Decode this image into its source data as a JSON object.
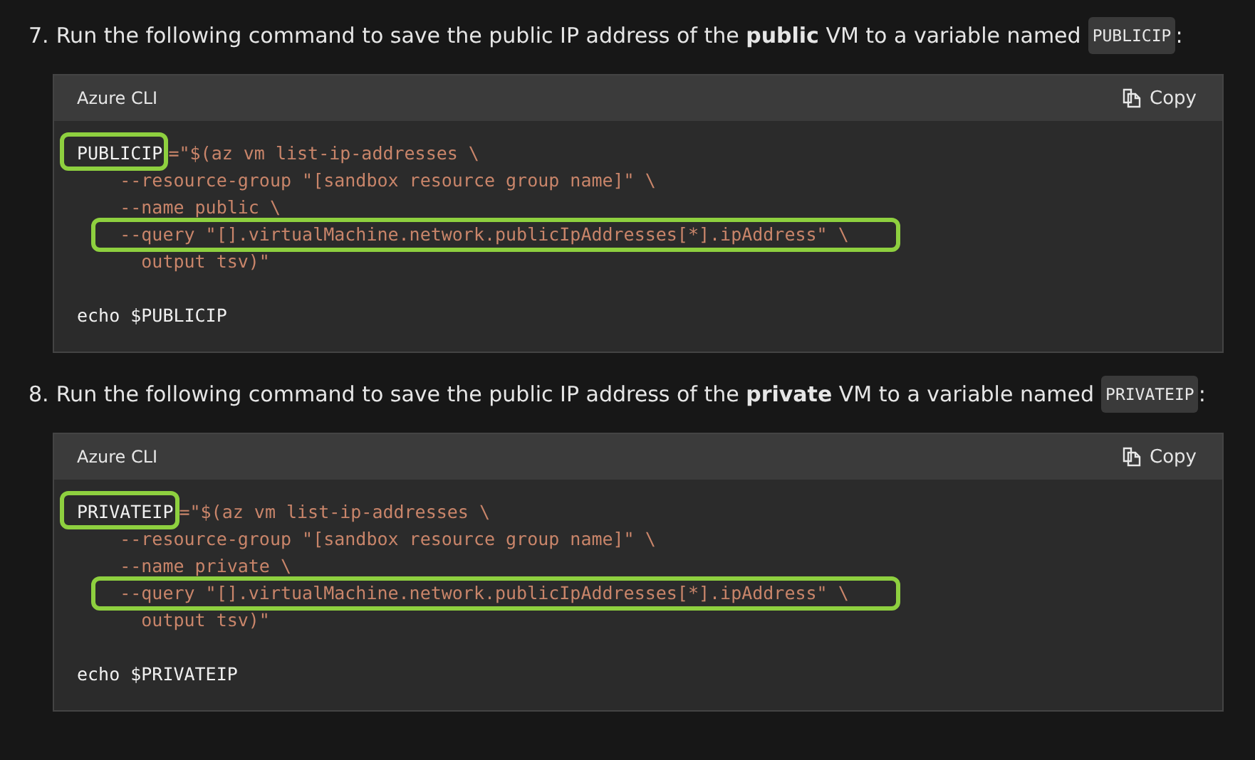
{
  "steps": [
    {
      "number": "7.",
      "text": "Run the following command to save the public IP address of the **public** VM to a variable named",
      "code": "PUBLICIP",
      "after": ":",
      "block": {
        "language": "Azure CLI",
        "copy_label": "Copy",
        "lines": [
          {
            "segments": [
              {
                "text": "PUBLICIP",
                "kind": "plain",
                "boxed": true
              },
              {
                "text": "=\"$(az vm list-ip-addresses \\",
                "kind": "string",
                "boxed": false
              }
            ]
          },
          {
            "segments": [
              {
                "text": "    --resource-group \"[sandbox resource group name]\" \\",
                "kind": "string",
                "boxed": false
              }
            ]
          },
          {
            "segments": [
              {
                "text": "    --name public \\",
                "kind": "string",
                "boxed": false
              }
            ]
          },
          {
            "segments": [
              {
                "text": "    --query \"[].virtualMachine.network.publicIpAddresses[*].ipAddress\" \\",
                "kind": "string",
                "boxed": true
              }
            ]
          },
          {
            "segments": [
              {
                "text": "      output tsv)\"",
                "kind": "string",
                "boxed": false
              }
            ]
          }
        ],
        "footer_lines": [
          {
            "segments": [
              {
                "text": "echo $PUBLICIP",
                "kind": "plain"
              }
            ]
          }
        ]
      }
    },
    {
      "number": "8.",
      "text": "Run the following command to save the public IP address of the **private** VM to a variable named",
      "code": "PRIVATEIP",
      "after": ":",
      "block": {
        "language": "Azure CLI",
        "copy_label": "Copy",
        "lines": [
          {
            "segments": [
              {
                "text": "PRIVATEIP",
                "kind": "plain",
                "boxed": true
              },
              {
                "text": "=\"$(az vm list-ip-addresses \\",
                "kind": "string",
                "boxed": false
              }
            ]
          },
          {
            "segments": [
              {
                "text": "    --resource-group \"[sandbox resource group name]\" \\",
                "kind": "string",
                "boxed": false
              }
            ]
          },
          {
            "segments": [
              {
                "text": "    --name private \\",
                "kind": "string",
                "boxed": false
              }
            ]
          },
          {
            "segments": [
              {
                "text": "    --query \"[].virtualMachine.network.publicIpAddresses[*].ipAddress\" \\",
                "kind": "string",
                "boxed": true
              }
            ]
          },
          {
            "segments": [
              {
                "text": "      output tsv)\"",
                "kind": "string",
                "boxed": false
              }
            ]
          }
        ],
        "footer_lines": [
          {
            "segments": [
              {
                "text": "echo $PRIVATEIP",
                "kind": "plain"
              }
            ]
          }
        ]
      }
    }
  ]
}
